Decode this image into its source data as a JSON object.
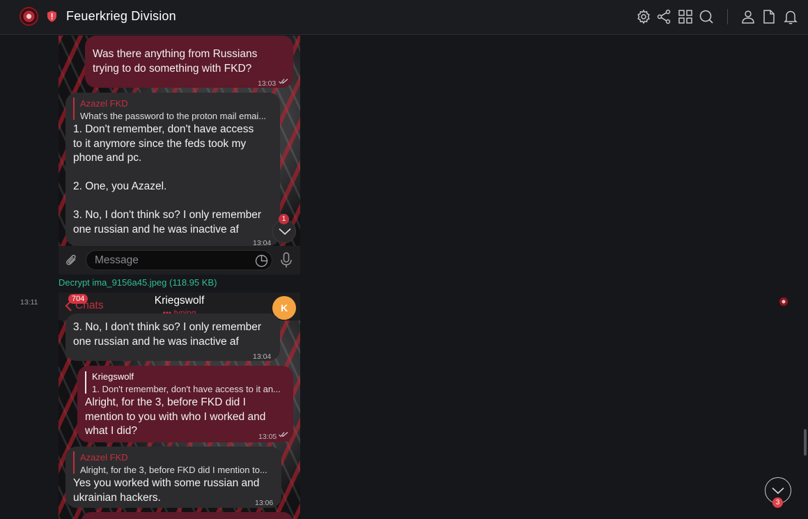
{
  "header": {
    "title": "Feuerkrieg Division"
  },
  "toolbar_icons": [
    "gear-icon",
    "share-icon",
    "grid-icon",
    "search-icon",
    "user-icon",
    "file-icon",
    "bell-icon"
  ],
  "screenshot1": {
    "messages": [
      {
        "dir": "out",
        "text": "Was there anything from Russians\ntrying to do something with FKD?",
        "time": "13:03"
      },
      {
        "dir": "in",
        "reply_name": "Azazel FKD",
        "reply_text": "What’s the password to the proton mail emai...",
        "text": "1. Don't remember, don't have access\nto it anymore since the feds took my\nphone and pc.\n\n2. One, you Azazel.\n\n3. No, I don't think so? I only remember\none russian and he was inactive af",
        "time": "13:04"
      }
    ],
    "scroll_badge": "1",
    "composer_placeholder": "Message"
  },
  "attachment": {
    "decrypt_label": "Decrypt ima_9156a45.jpeg (118.95 KB)"
  },
  "message_time": "13:11",
  "screenshot2": {
    "header": {
      "back_label": "Chats",
      "unread": "704",
      "contact": "Kriegswolf",
      "status": "••• typing",
      "avatar_letter": "K"
    },
    "messages": [
      {
        "dir": "in",
        "text": "3. No, I don't think so? I only remember\none russian and he was inactive af",
        "time": "13:04"
      },
      {
        "dir": "out",
        "reply_name": "Kriegswolf",
        "reply_text": "1. Don't remember, don't have access to it an...",
        "text": "Alright, for the 3, before FKD did I\nmention to you with who I worked and\nwhat I did?",
        "time": "13:05"
      },
      {
        "dir": "in",
        "reply_name": "Azazel FKD",
        "reply_text": "Alright, for the 3, before FKD did I mention to...",
        "text": "Yes you worked with some russian and\nukrainian hackers.",
        "time": "13:06"
      }
    ]
  },
  "scroll_button_badge": "3",
  "colors": {
    "accent": "#c4303c",
    "decrypt": "#2fbf8f",
    "outgoing_bubble": "#5c1a2a",
    "incoming_bubble": "#2c2c2f"
  }
}
